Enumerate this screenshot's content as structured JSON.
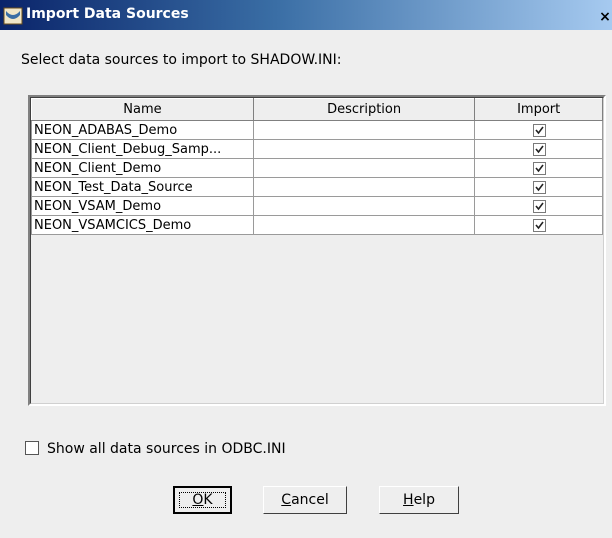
{
  "window": {
    "title": "Import Data Sources",
    "close_glyph": "×"
  },
  "instruction": "Select data sources to import to SHADOW.INI:",
  "table": {
    "columns": [
      "Name",
      "Description",
      "Import"
    ],
    "rows": [
      {
        "name": "NEON_ADABAS_Demo",
        "description": "",
        "import": true
      },
      {
        "name": "NEON_Client_Debug_Samp...",
        "description": "",
        "import": true
      },
      {
        "name": "NEON_Client_Demo",
        "description": "",
        "import": true
      },
      {
        "name": "NEON_Test_Data_Source",
        "description": "",
        "import": true
      },
      {
        "name": "NEON_VSAM_Demo",
        "description": "",
        "import": true
      },
      {
        "name": "NEON_VSAMCICS_Demo",
        "description": "",
        "import": true
      }
    ]
  },
  "show_all": {
    "label": "Show all data sources in ODBC.INI",
    "checked": false
  },
  "buttons": {
    "ok": {
      "mnemonic": "O",
      "rest": "K"
    },
    "cancel": {
      "mnemonic": "C",
      "rest": "ancel"
    },
    "help": {
      "mnemonic": "H",
      "rest": "elp"
    }
  },
  "colors": {
    "title_gradient_start": "#0a246a",
    "title_gradient_end": "#a6caf0",
    "dialog_background": "#eeeeee"
  },
  "icons": {
    "title": "app-window-icon",
    "check": "check-icon"
  }
}
